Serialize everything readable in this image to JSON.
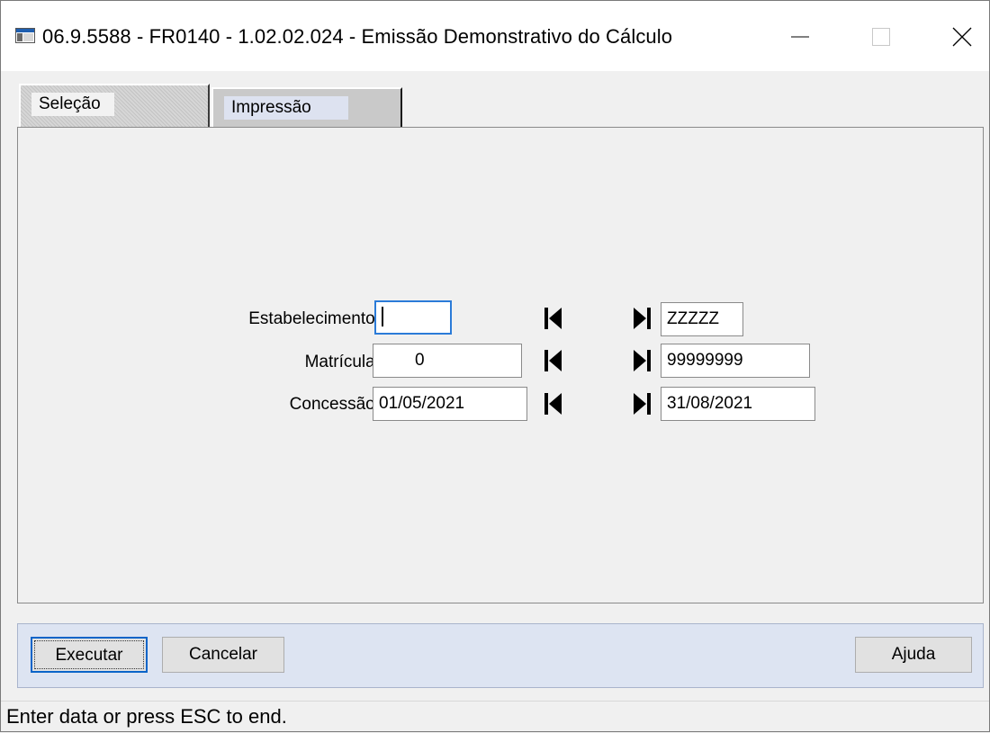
{
  "window": {
    "title": "06.9.5588 - FR0140 - 1.02.02.024 - Emissão Demonstrativo do Cálculo"
  },
  "tabs": [
    {
      "label": "Seleção",
      "active": true
    },
    {
      "label": "Impressão",
      "active": false
    }
  ],
  "form": {
    "estabelecimento": {
      "label": "Estabelecimento:",
      "from": "",
      "to": "ZZZZZ"
    },
    "matricula": {
      "label": "Matrícula:",
      "from": "0",
      "to": "99999999"
    },
    "concessao": {
      "label": "Concessão:",
      "from": "01/05/2021",
      "to": "31/08/2021"
    }
  },
  "buttons": {
    "executar": "Executar",
    "cancelar": "Cancelar",
    "ajuda": "Ajuda"
  },
  "status": "Enter data or press ESC to end.",
  "icons": {
    "app": "window-app-icon",
    "first": "first-record-icon",
    "last": "last-record-icon"
  },
  "colors": {
    "focus_border": "#2b7bd8",
    "bottom_bar": "#dde4f2",
    "default_button_border": "#0a64c8"
  }
}
